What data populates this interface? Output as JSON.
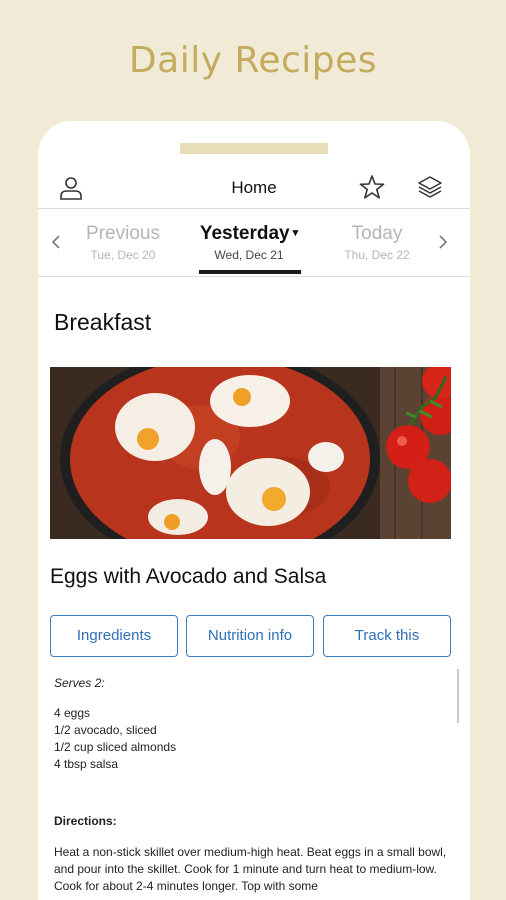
{
  "promo": {
    "title": "Daily Recipes"
  },
  "appbar": {
    "title": "Home",
    "icons": [
      "user-icon",
      "star-icon",
      "layers-icon"
    ]
  },
  "daynav": {
    "previous": {
      "name": "Previous",
      "date": "Tue, Dec 20"
    },
    "current": {
      "name": "Yesterday",
      "date": "Wed, Dec 21"
    },
    "next": {
      "name": "Today",
      "date": "Thu, Dec 22"
    }
  },
  "meal": {
    "section": "Breakfast",
    "image": "shakshuka-eggs-in-tomato-sauce-photo",
    "title": "Eggs with Avocado and Salsa",
    "buttons": {
      "ingredients": "Ingredients",
      "nutrition": "Nutrition info",
      "track": "Track this"
    },
    "serves": "Serves 2:",
    "ingredients": [
      "4 eggs",
      "1/2 avocado, sliced",
      "1/2 cup sliced almonds",
      "4 tbsp salsa"
    ],
    "directions_label": "Directions:",
    "directions": "Heat a non-stick skillet over medium-high heat. Beat eggs in a small bowl, and pour into the skillet. Cook for 1 minute and turn heat to medium-low. Cook for about 2-4 minutes longer. Top with some"
  },
  "colors": {
    "background": "#f0ead6",
    "promo_title": "#c4ab5e",
    "accent_blue": "#2f6fb8",
    "notch": "#e8ddb8"
  }
}
